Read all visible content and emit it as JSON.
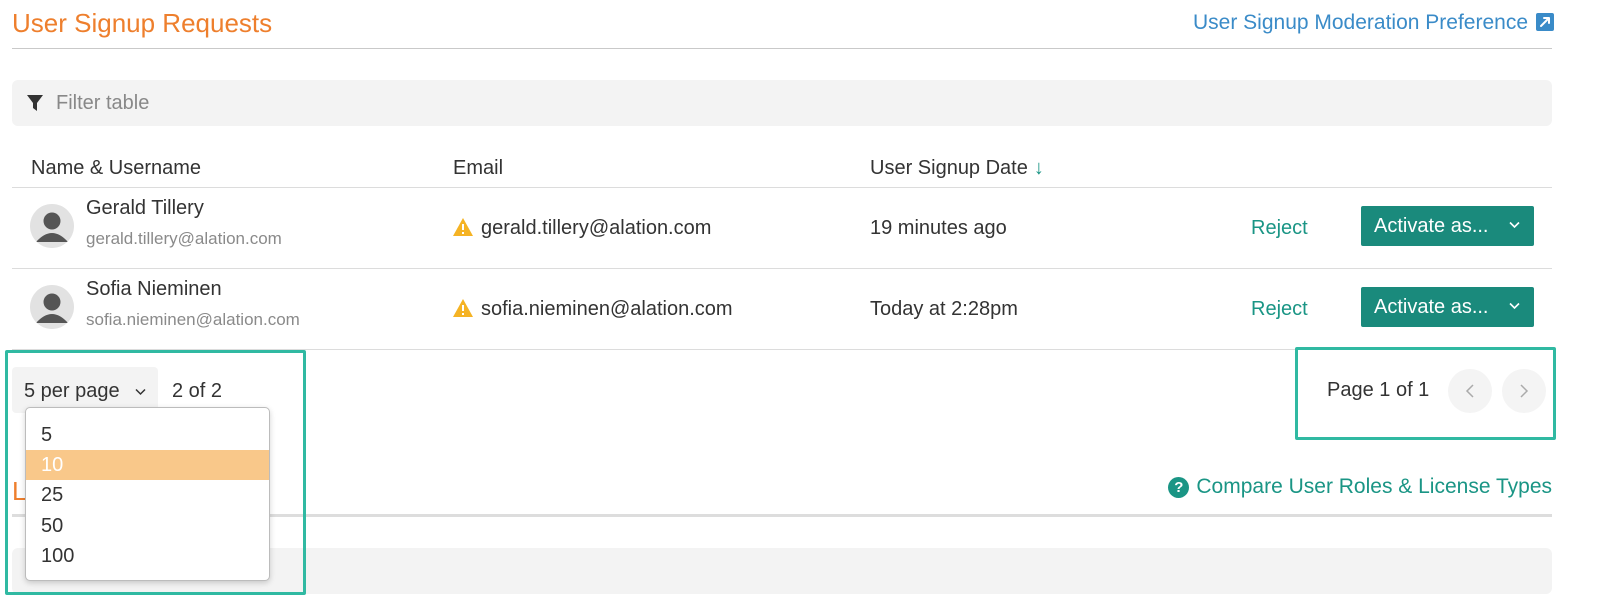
{
  "header": {
    "title": "User Signup Requests",
    "preference_link": "User Signup Moderation Preference"
  },
  "filter": {
    "placeholder": "Filter table",
    "icon": "funnel-icon"
  },
  "table": {
    "columns": [
      "Name & Username",
      "Email",
      "User Signup Date"
    ],
    "sort_indicator": "↓",
    "rows": [
      {
        "name": "Gerald Tillery",
        "username": "gerald.tillery@alation.com",
        "email": "gerald.tillery@alation.com",
        "signup_date": "19 minutes ago",
        "reject_label": "Reject",
        "activate_label": "Activate as..."
      },
      {
        "name": "Sofia Nieminen",
        "username": "sofia.nieminen@alation.com",
        "email": "sofia.nieminen@alation.com",
        "signup_date": "Today at 2:28pm",
        "reject_label": "Reject",
        "activate_label": "Activate as..."
      }
    ]
  },
  "pagination": {
    "per_page_label": "5 per page",
    "count_text": "2 of 2",
    "page_info": "Page 1 of 1",
    "options": [
      "5",
      "10",
      "25",
      "50",
      "100"
    ],
    "highlighted_option": "10"
  },
  "section2": {
    "title_partial": "L",
    "compare_link": "Compare User Roles & License Types"
  },
  "colors": {
    "title_orange": "#ee7f2d",
    "link_blue": "#3a8bc8",
    "teal": "#1a9585",
    "button_teal": "#1a8a7c",
    "warning_yellow": "#f5b324",
    "option_highlight": "#f9c88a",
    "annotation_box": "#30b9a2"
  }
}
